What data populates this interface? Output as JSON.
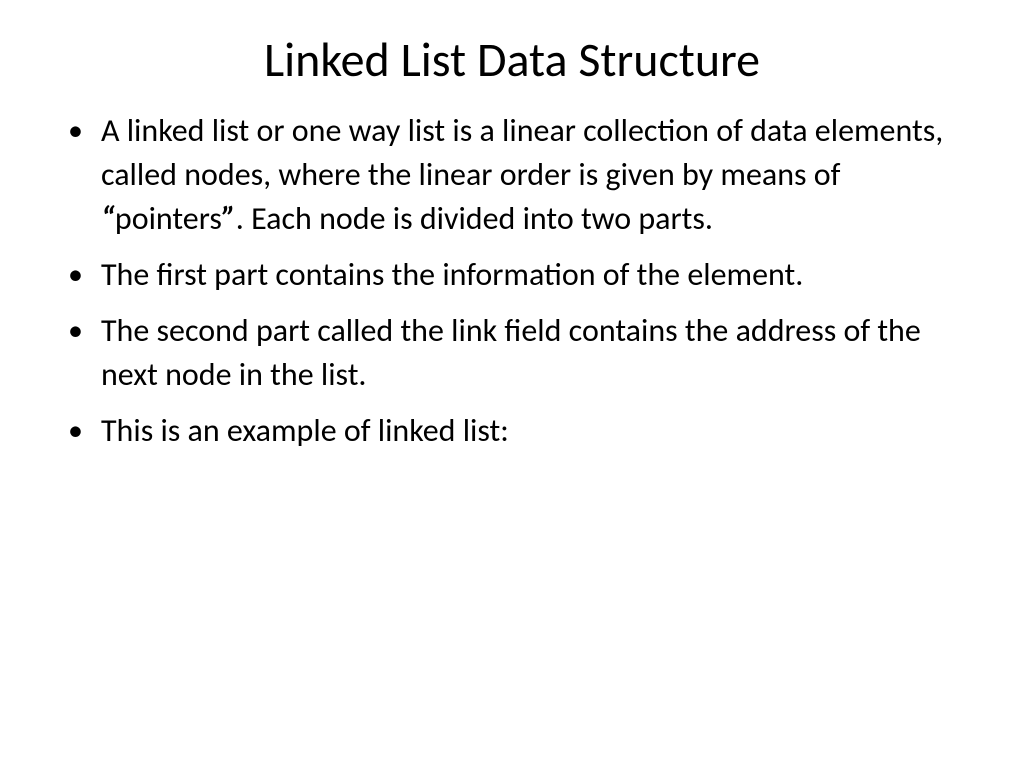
{
  "slide": {
    "title": "Linked List Data Structure",
    "bullets": [
      {
        "pre": "A linked list or one way list is a linear collection of data elements, called nodes, where the linear order is given by means of ",
        "q1": "“",
        "mid": "pointers",
        "q2": "”",
        "post": ". Each node is divided into two parts."
      },
      {
        "pre": "The first part contains the information of the element."
      },
      {
        "pre": "The second part called the link field contains the address of the next node in the list."
      },
      {
        "pre": "This is an example of linked list:"
      }
    ]
  }
}
